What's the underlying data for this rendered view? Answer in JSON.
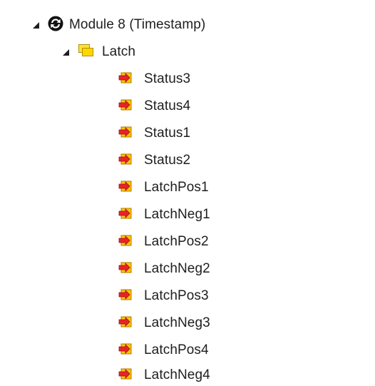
{
  "tree": {
    "module": {
      "label": "Module 8 (Timestamp)",
      "icon": "module-icon"
    },
    "group": {
      "label": "Latch",
      "icon": "folder-icon"
    },
    "variables": [
      {
        "label": "Status3",
        "icon": "input-variable-icon"
      },
      {
        "label": "Status4",
        "icon": "input-variable-icon"
      },
      {
        "label": "Status1",
        "icon": "input-variable-icon"
      },
      {
        "label": "Status2",
        "icon": "input-variable-icon"
      },
      {
        "label": "LatchPos1",
        "icon": "input-variable-icon"
      },
      {
        "label": "LatchNeg1",
        "icon": "input-variable-icon"
      },
      {
        "label": "LatchPos2",
        "icon": "input-variable-icon"
      },
      {
        "label": "LatchNeg2",
        "icon": "input-variable-icon"
      },
      {
        "label": "LatchPos3",
        "icon": "input-variable-icon"
      },
      {
        "label": "LatchNeg3",
        "icon": "input-variable-icon"
      },
      {
        "label": "LatchPos4",
        "icon": "input-variable-icon"
      },
      {
        "label": "LatchNeg4",
        "icon": "input-variable-icon"
      }
    ]
  }
}
